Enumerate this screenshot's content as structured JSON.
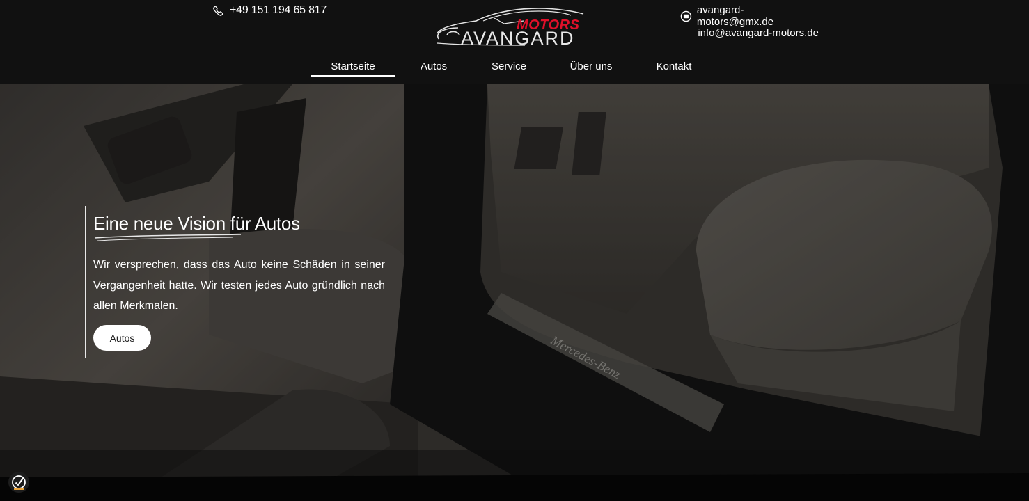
{
  "header": {
    "phone": "+49 151 194 65 817",
    "email_1": "avangard-motors@gmx.de",
    "email_2": "info@avangard-motors.de",
    "logo": {
      "word_top": "MOTORS",
      "word_bottom": "AVANGARD"
    }
  },
  "nav": {
    "items": [
      {
        "label": "Startseite",
        "active": true
      },
      {
        "label": "Autos",
        "active": false
      },
      {
        "label": "Service",
        "active": false
      },
      {
        "label": "Über uns",
        "active": false
      },
      {
        "label": "Kontakt",
        "active": false
      }
    ]
  },
  "hero": {
    "title": "Eine neue Vision für Autos",
    "text": "Wir versprechen, dass das Auto keine Schäden in seiner Vergangenheit hatte. Wir testen jedes Auto gründlich nach allen Merkmalen.",
    "button_label": "Autos",
    "background_image": {
      "description_icons": [
        "car-door-interior",
        "seat",
        "pedals",
        "sill-plate"
      ],
      "sill_plate_text": "Mercedes-Benz"
    }
  },
  "icons": {
    "phone": "phone-icon",
    "email": "email-icon",
    "cookie": "cookie-settings-icon"
  },
  "colors": {
    "header_bg": "#111111",
    "accent_red": "#e0102a",
    "text": "#ffffff"
  }
}
